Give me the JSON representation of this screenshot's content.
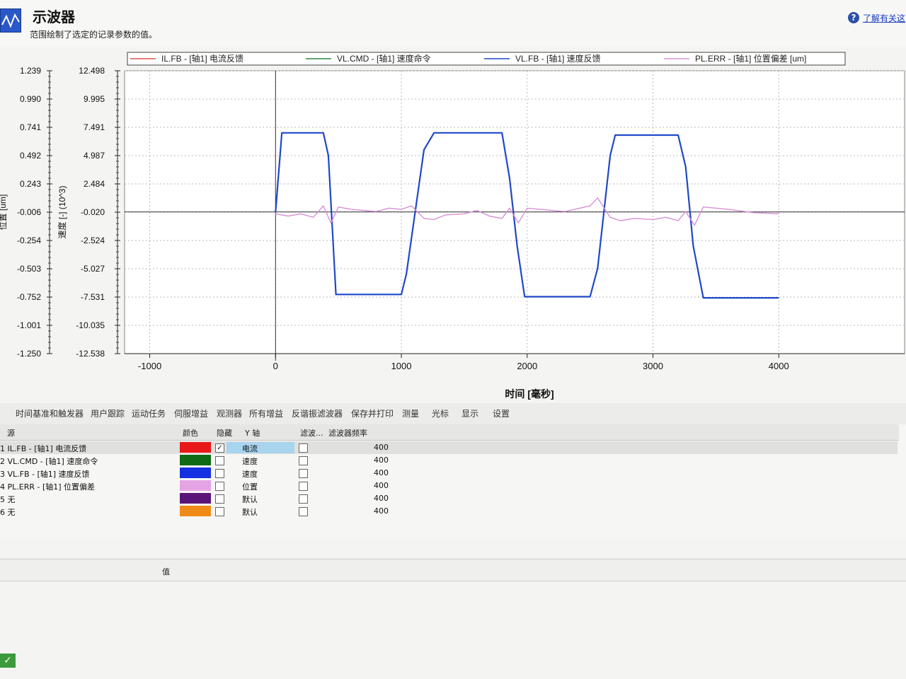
{
  "header": {
    "title": "示波器",
    "subtitle": "范围绘制了选定的记录参数的值。",
    "help_link": "了解有关这"
  },
  "chart_data": {
    "type": "line",
    "legend": [
      {
        "label": "IL.FB - [轴1] 电流反馈",
        "color": "#e05050"
      },
      {
        "label": "VL.CMD - [轴1] 速度命令",
        "color": "#2a8a3a"
      },
      {
        "label": "VL.FB - [轴1] 速度反馈",
        "color": "#2048c8"
      },
      {
        "label": "PL.ERR - [轴1] 位置偏差 [um]",
        "color": "#d890d8"
      }
    ],
    "xlabel": "时间 [毫秒]",
    "xlim": [
      -1200,
      5000
    ],
    "xticks": [
      "-1000",
      "0",
      "1000",
      "2000",
      "3000",
      "4000"
    ],
    "y_axes": [
      {
        "label": "位置 [um]",
        "min": -1.25,
        "max": 1.239,
        "ticks": [
          "1.239",
          "0.990",
          "0.741",
          "0.492",
          "0.243",
          "-0.006",
          "-0.254",
          "-0.503",
          "-0.752",
          "-1.001",
          "-1.250"
        ]
      },
      {
        "label": "速度 [-] (10^3)",
        "min": -12.538,
        "max": 12.498,
        "ticks": [
          "12.498",
          "9.995",
          "7.491",
          "4.987",
          "2.484",
          "-0.020",
          "-2.524",
          "-5.027",
          "-7.531",
          "-10.035",
          "-12.538"
        ]
      }
    ],
    "grid": true,
    "series": [
      {
        "name": "VL.CMD - [轴1] 速度命令",
        "axis": "速度 [-] (10^3)",
        "color": "#2a8a3a",
        "x": [
          0,
          50,
          380,
          420,
          480,
          1000,
          1040,
          1180,
          1260,
          1800,
          1860,
          1920,
          1980,
          2500,
          2560,
          2660,
          2700,
          3200,
          3260,
          3320,
          3400,
          4000
        ],
        "values": [
          -0.02,
          7.0,
          7.0,
          5.0,
          -7.3,
          -7.3,
          -5.5,
          5.5,
          7.0,
          7.0,
          3.0,
          -3.0,
          -7.5,
          -7.5,
          -5.0,
          5.0,
          6.8,
          6.8,
          4.0,
          -3.0,
          -7.6,
          -7.6
        ]
      },
      {
        "name": "VL.FB - [轴1] 速度反馈",
        "axis": "速度 [-] (10^3)",
        "color": "#2048c8",
        "x": [
          0,
          50,
          380,
          420,
          480,
          1000,
          1040,
          1180,
          1260,
          1800,
          1860,
          1920,
          1980,
          2500,
          2560,
          2660,
          2700,
          3200,
          3260,
          3320,
          3400,
          4000
        ],
        "values": [
          -0.02,
          7.0,
          7.0,
          5.0,
          -7.3,
          -7.3,
          -5.5,
          5.5,
          7.0,
          7.0,
          3.0,
          -3.0,
          -7.5,
          -7.5,
          -5.0,
          5.0,
          6.8,
          6.8,
          4.0,
          -3.0,
          -7.6,
          -7.6
        ]
      },
      {
        "name": "PL.ERR - [轴1] 位置偏差 [um]",
        "axis": "位置 [um]",
        "color": "#d890d8",
        "x": [
          0,
          100,
          200,
          300,
          380,
          440,
          500,
          600,
          700,
          800,
          900,
          1000,
          1080,
          1180,
          1260,
          1350,
          1500,
          1600,
          1700,
          1800,
          1860,
          1930,
          2000,
          2100,
          2300,
          2500,
          2560,
          2660,
          2740,
          2850,
          3000,
          3100,
          3200,
          3260,
          3330,
          3400,
          3600,
          3800,
          4000
        ],
        "values": [
          -0.02,
          -0.04,
          -0.02,
          -0.05,
          0.05,
          -0.1,
          0.04,
          0.02,
          0.01,
          0.0,
          0.03,
          0.02,
          0.05,
          -0.06,
          -0.07,
          -0.03,
          -0.02,
          0.01,
          -0.04,
          -0.06,
          0.03,
          -0.1,
          0.03,
          0.02,
          0.0,
          0.05,
          0.12,
          -0.05,
          -0.08,
          -0.06,
          -0.07,
          -0.05,
          -0.08,
          0.0,
          -0.12,
          0.04,
          0.02,
          -0.01,
          -0.02
        ]
      }
    ]
  },
  "tabs": [
    "时间基准和触发器",
    "用户跟踪",
    "运动任务",
    "伺服增益",
    "观测器",
    "所有增益",
    "反谐振滤波器",
    "保存并打印",
    "测量",
    "光标",
    "显示",
    "设置"
  ],
  "grid": {
    "headers": {
      "source": "源",
      "color": "颜色",
      "hidden": "隐藏",
      "y_axis": "Y 轴",
      "filter": "滤波...",
      "filter_freq": "滤波器频率"
    },
    "rows": [
      {
        "source": "1 IL.FB - [轴1] 电流反馈",
        "color": "#e81818",
        "hidden": true,
        "y_axis": "电流",
        "freq": "400"
      },
      {
        "source": "2 VL.CMD - [轴1] 速度命令",
        "color": "#0e6a14",
        "hidden": false,
        "y_axis": "速度",
        "freq": "400"
      },
      {
        "source": "3 VL.FB - [轴1] 速度反馈",
        "color": "#1430e0",
        "hidden": false,
        "y_axis": "速度",
        "freq": "400"
      },
      {
        "source": "4 PL.ERR - [轴1] 位置偏差",
        "color": "#e4a4e4",
        "hidden": false,
        "y_axis": "位置",
        "freq": "400"
      },
      {
        "source": "5 无",
        "color": "#5a1478",
        "hidden": false,
        "y_axis": "默认",
        "freq": "400"
      },
      {
        "source": "6 无",
        "color": "#f08a18",
        "hidden": false,
        "y_axis": "默认",
        "freq": "400"
      }
    ]
  },
  "bottom": {
    "value_header": "值"
  }
}
